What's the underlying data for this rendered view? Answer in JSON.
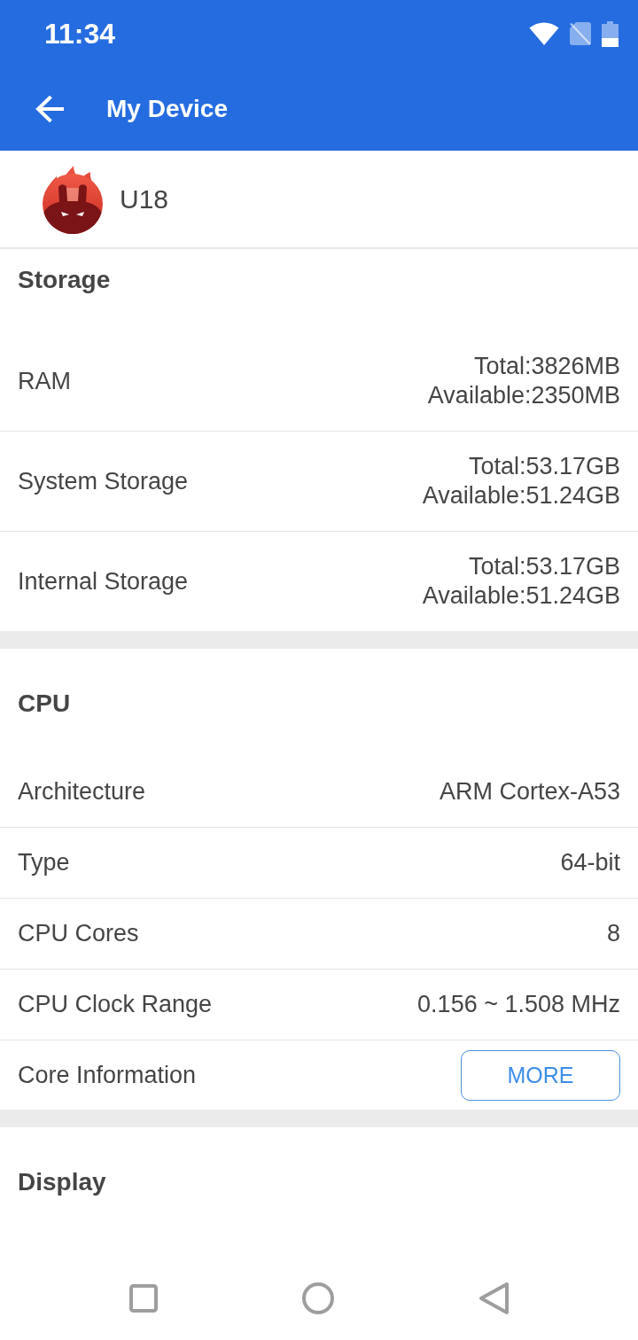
{
  "status_bar": {
    "time": "11:34"
  },
  "app_bar": {
    "title": "My Device"
  },
  "device": {
    "name": "U18"
  },
  "sections": [
    {
      "title": "Storage",
      "rows": [
        {
          "kind": "text",
          "label": "RAM",
          "values": [
            "Total:3826MB",
            "Available:2350MB"
          ]
        },
        {
          "kind": "text",
          "label": "System Storage",
          "values": [
            "Total:53.17GB",
            "Available:51.24GB"
          ]
        },
        {
          "kind": "text",
          "label": "Internal Storage",
          "values": [
            "Total:53.17GB",
            "Available:51.24GB"
          ]
        }
      ]
    },
    {
      "title": "CPU",
      "rows": [
        {
          "kind": "text",
          "label": "Architecture",
          "values": [
            "ARM Cortex-A53"
          ]
        },
        {
          "kind": "text",
          "label": "Type",
          "values": [
            "64-bit"
          ]
        },
        {
          "kind": "text",
          "label": "CPU Cores",
          "values": [
            "8"
          ]
        },
        {
          "kind": "text",
          "label": "CPU Clock Range",
          "values": [
            "0.156 ~ 1.508 MHz"
          ]
        },
        {
          "kind": "button",
          "label": "Core Information",
          "button": "MORE"
        }
      ]
    },
    {
      "title": "Display"
    }
  ]
}
